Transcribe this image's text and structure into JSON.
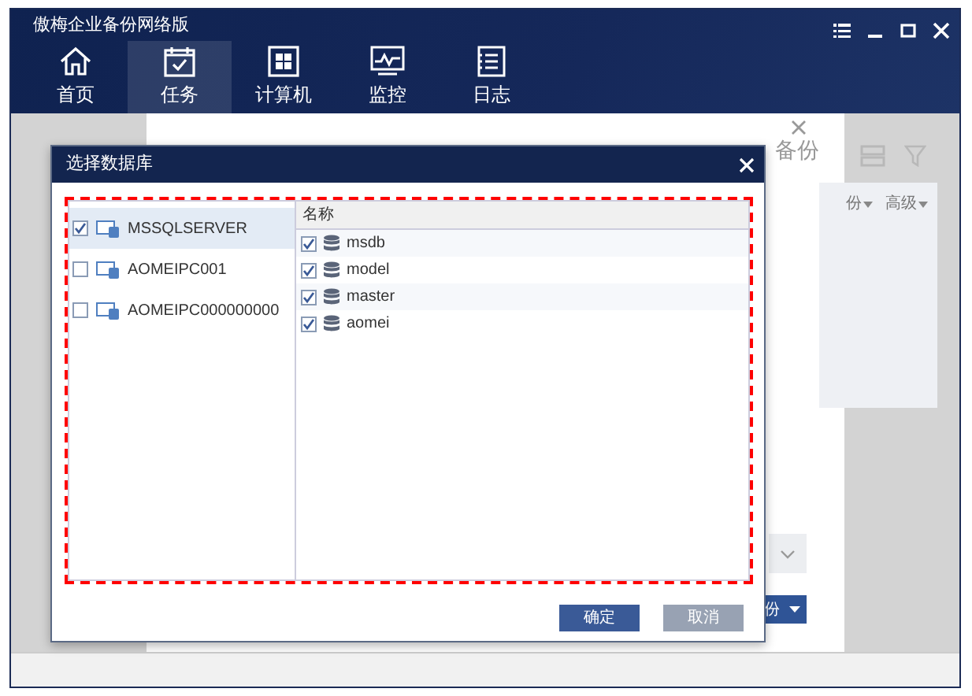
{
  "window": {
    "title": "傲梅企业备份网络版"
  },
  "nav": [
    {
      "label": "首页",
      "kind": "home",
      "selected": false
    },
    {
      "label": "任务",
      "kind": "task",
      "selected": true
    },
    {
      "label": "计算机",
      "kind": "computer",
      "selected": false
    },
    {
      "label": "监控",
      "kind": "monitor",
      "selected": false
    },
    {
      "label": "日志",
      "kind": "log",
      "selected": false
    }
  ],
  "background_panel": {
    "heading": "备份",
    "filters": [
      "份",
      "高级"
    ],
    "button": "份"
  },
  "dialog": {
    "title": "选择数据库",
    "servers": [
      {
        "name": "MSSQLSERVER",
        "checked": true,
        "selected": true
      },
      {
        "name": "AOMEIPC001",
        "checked": false,
        "selected": false
      },
      {
        "name": "AOMEIPC000000000",
        "checked": false,
        "selected": false
      }
    ],
    "column": "名称",
    "databases": [
      {
        "name": "msdb",
        "checked": true
      },
      {
        "name": "model",
        "checked": true
      },
      {
        "name": "master",
        "checked": true
      },
      {
        "name": "aomei",
        "checked": true
      }
    ],
    "buttons": [
      {
        "label": "确定",
        "kind": "primary"
      },
      {
        "label": "取消",
        "kind": "secondary"
      }
    ]
  }
}
